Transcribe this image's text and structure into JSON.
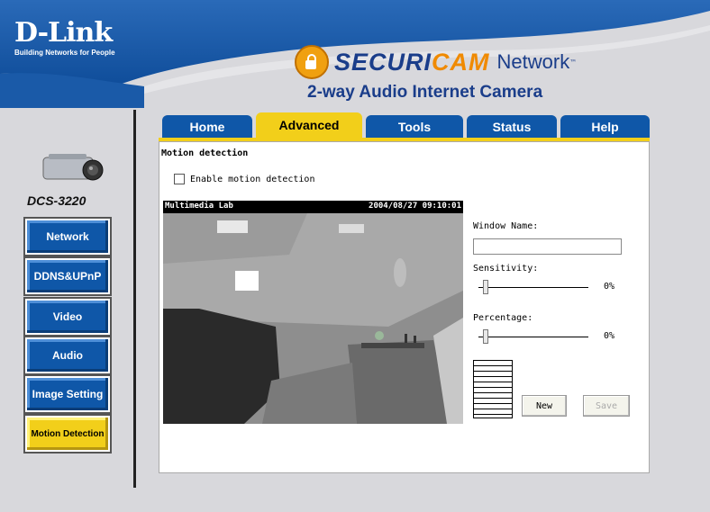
{
  "header": {
    "logo_main": "D-Link",
    "logo_sub": "Building Networks for People",
    "brand_part1": "SECURI",
    "brand_part2": "CAM",
    "brand_part3": "Network",
    "brand_tm": "™",
    "subtitle": "2-way Audio Internet Camera"
  },
  "sidebar": {
    "model": "DCS-3220",
    "items": [
      {
        "label": "Network"
      },
      {
        "label": "DDNS&UPnP"
      },
      {
        "label": "Video"
      },
      {
        "label": "Audio"
      },
      {
        "label": "Image Setting"
      },
      {
        "label": "Motion Detection",
        "active": true
      }
    ]
  },
  "tabs": [
    {
      "label": "Home"
    },
    {
      "label": "Advanced",
      "active": true
    },
    {
      "label": "Tools"
    },
    {
      "label": "Status"
    },
    {
      "label": "Help"
    }
  ],
  "main": {
    "section_title": "Motion detection",
    "enable_label": "Enable motion detection",
    "enable_checked": false,
    "video": {
      "osd_left": "Multimedia Lab",
      "osd_right": "2004/08/27 09:10:01"
    },
    "window_name_label": "Window Name:",
    "window_name_value": "",
    "sensitivity_label": "Sensitivity:",
    "sensitivity_value": "0%",
    "percentage_label": "Percentage:",
    "percentage_value": "0%",
    "new_button": "New",
    "save_button": "Save"
  },
  "colors": {
    "header_blue": "#1a5aa8",
    "nav_blue": "#0f57a8",
    "active_yellow": "#f2cf1a",
    "brand_orange": "#f08a00"
  }
}
